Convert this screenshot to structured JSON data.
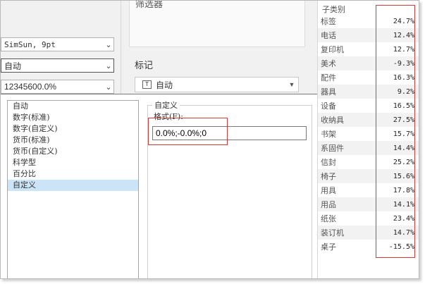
{
  "filter_section_label": "筛选器",
  "font_select": {
    "value": "SimSun, 9pt"
  },
  "alignment_select": {
    "value": "自动"
  },
  "number_select": {
    "value": "12345600.0%"
  },
  "marks": {
    "title": "标记",
    "mark_type": "自动",
    "mark_icon": "T"
  },
  "format_dialog": {
    "types": [
      "自动",
      "数字(标准)",
      "数字(自定义)",
      "货币(标准)",
      "货币(自定义)",
      "科学型",
      "百分比",
      "自定义"
    ],
    "selected_type": "自定义",
    "custom_group_title": "自定义",
    "format_label": "格式(F):",
    "format_value": "0.0%;-0.0%;0"
  },
  "table": {
    "header": "子类别",
    "rows": [
      {
        "category": "标签",
        "value": "24.7%"
      },
      {
        "category": "电话",
        "value": "12.4%"
      },
      {
        "category": "复印机",
        "value": "12.7%"
      },
      {
        "category": "美术",
        "value": "-9.3%"
      },
      {
        "category": "配件",
        "value": "16.3%"
      },
      {
        "category": "器具",
        "value": "9.2%"
      },
      {
        "category": "设备",
        "value": "16.5%"
      },
      {
        "category": "收纳具",
        "value": "27.5%"
      },
      {
        "category": "书架",
        "value": "15.7%"
      },
      {
        "category": "系固件",
        "value": "14.4%"
      },
      {
        "category": "信封",
        "value": "25.2%"
      },
      {
        "category": "椅子",
        "value": "15.6%"
      },
      {
        "category": "用具",
        "value": "17.8%"
      },
      {
        "category": "用品",
        "value": "14.1%"
      },
      {
        "category": "纸张",
        "value": "23.4%"
      },
      {
        "category": "装订机",
        "value": "14.7%"
      },
      {
        "category": "桌子",
        "value": "-15.5%"
      }
    ]
  },
  "colors": {
    "highlight": "#d43b3b",
    "selection": "#cce4f7"
  }
}
